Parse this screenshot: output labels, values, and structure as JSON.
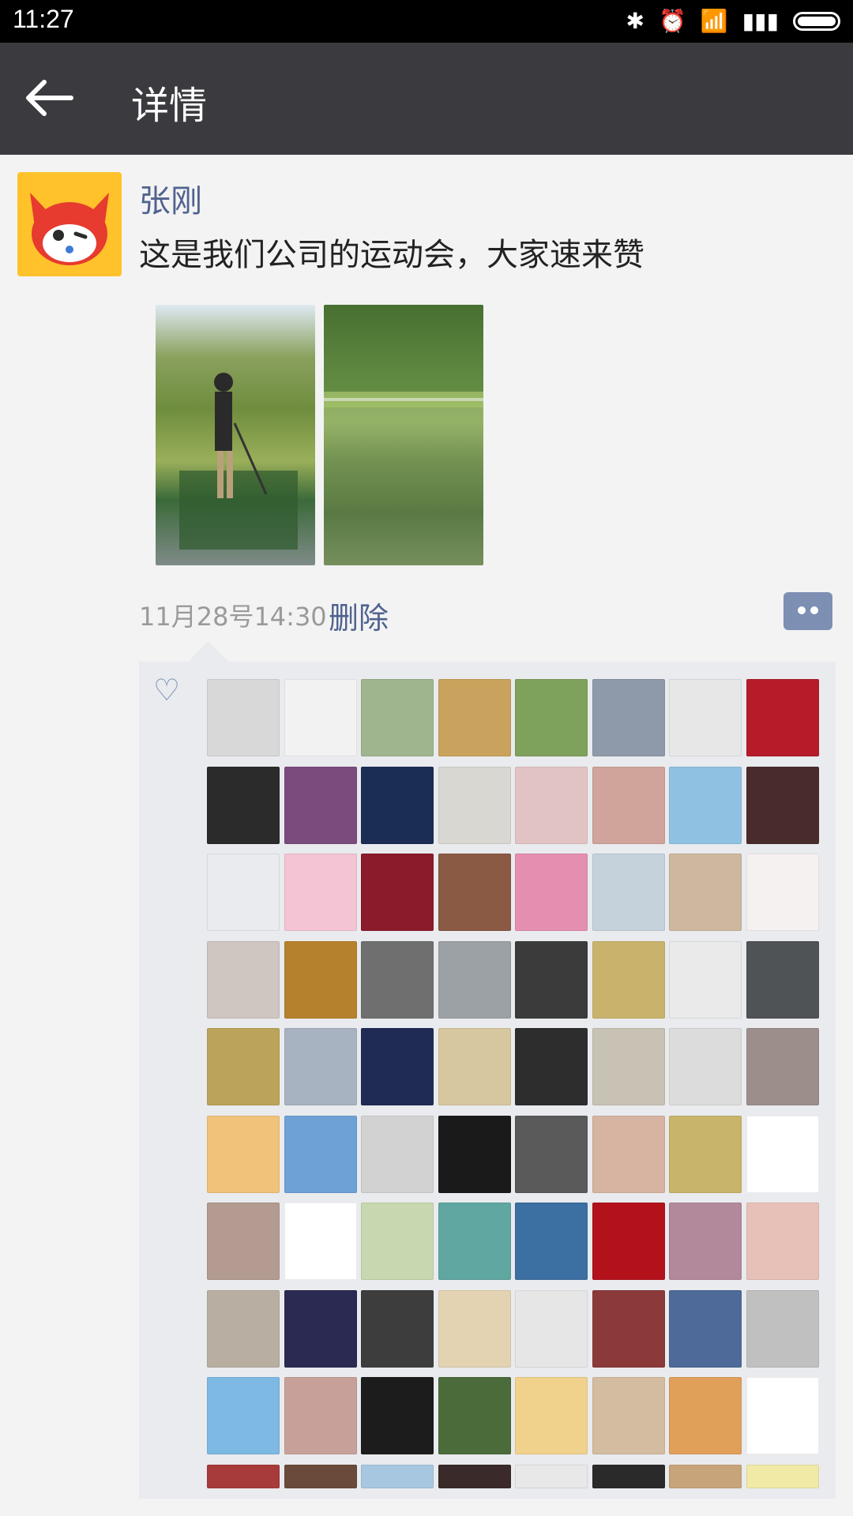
{
  "status": {
    "time": "11:27",
    "icons": [
      "bluetooth-icon",
      "alarm-icon",
      "wifi-icon",
      "signal-icon",
      "battery-icon"
    ]
  },
  "header": {
    "title": "详情"
  },
  "post": {
    "author": "张刚",
    "text": "这是我们公司的运动会，大家速来赞",
    "photos": [
      {
        "name": "photo-golf"
      },
      {
        "name": "photo-lake"
      }
    ],
    "time": "11月28号14:30",
    "delete_label": "删除"
  },
  "likes": {
    "avatars_count": 80
  },
  "colors": {
    "app_bar": "#3a3a3f",
    "link": "#50628f",
    "panel_bg": "#e9ebee"
  }
}
